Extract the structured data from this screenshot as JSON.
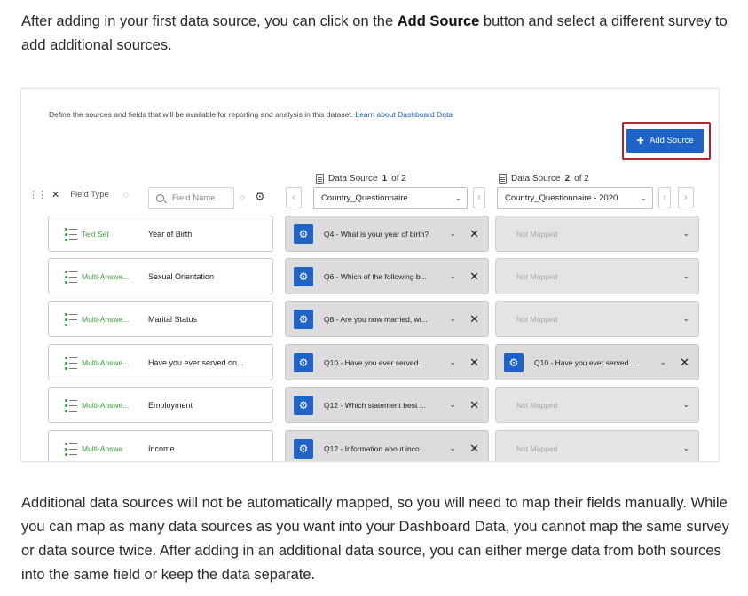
{
  "intro": {
    "before": "After adding in your first data source, you can click on the ",
    "bold": "Add Source",
    "after": " button and select a different survey to add additional sources."
  },
  "screenshot": {
    "define_text": "Define the sources and fields that will be available for reporting and analysis in this dataset.",
    "learn_link": "Learn about Dashboard Data",
    "add_source_label": "Add Source",
    "toolbar": {
      "field_type_label": "Field Type",
      "search_placeholder": "Field Name"
    },
    "sources": [
      {
        "title_prefix": "Data Source",
        "index": "1",
        "title_suffix": "of 2",
        "selected": "Country_Questionnaire"
      },
      {
        "title_prefix": "Data Source",
        "index": "2",
        "title_suffix": "of 2",
        "selected": "Country_Questionnaire - 2020"
      }
    ],
    "not_mapped_label": "Not Mapped",
    "rows": [
      {
        "type": "Text Set",
        "field": "Year of Birth",
        "source1": "Q4 - What is your year of birth?",
        "source2": ""
      },
      {
        "type": "Multi-Answe...",
        "field": "Sexual Orientation",
        "source1": "Q6 - Which of the following b...",
        "source2": ""
      },
      {
        "type": "Multi-Answe...",
        "field": "Marital Status",
        "source1": "Q8 - Are you now married, wi...",
        "source2": ""
      },
      {
        "type": "Multi-Answe...",
        "field": "Have you ever served on...",
        "source1": "Q10 - Have you ever served ...",
        "source2": "Q10 - Have you ever served ..."
      },
      {
        "type": "Multi-Answe...",
        "field": "Employment",
        "source1": "Q12 - Which statement best ...",
        "source2": ""
      },
      {
        "type": "Multi-Answe",
        "field": "Income",
        "source1": "Q12 - Information about inco...",
        "source2": ""
      }
    ]
  },
  "outro": "Additional data sources will not be automatically mapped, so you will need to map their fields manually. While you can map as many data sources as you want into your Dashboard Data, you cannot map the same survey or data source twice. After adding in an additional data source, you can either merge data from both sources into the same field or keep the data separate.",
  "colors": {
    "accent_blue": "#1f63c6",
    "highlight_red": "#b4222e",
    "type_green": "#3a9b3a"
  }
}
